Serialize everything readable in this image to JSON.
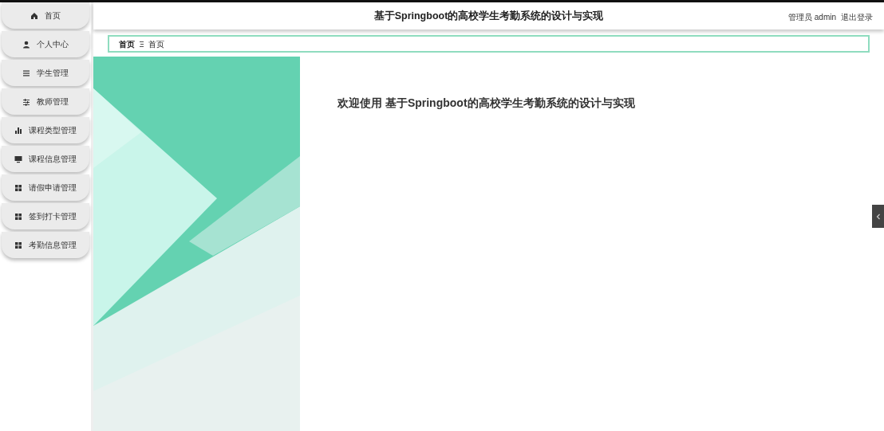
{
  "sidebar": {
    "items": [
      {
        "label": "首页",
        "kind": "home"
      },
      {
        "label": "个人中心",
        "kind": "user"
      },
      {
        "label": "学生管理",
        "kind": "list"
      },
      {
        "label": "教师管理",
        "kind": "sliders"
      },
      {
        "label": "课程类型管理",
        "kind": "chart"
      },
      {
        "label": "课程信息管理",
        "kind": "monitor"
      },
      {
        "label": "请假申请管理",
        "kind": "grid"
      },
      {
        "label": "签到打卡管理",
        "kind": "grid"
      },
      {
        "label": "考勤信息管理",
        "kind": "grid"
      }
    ]
  },
  "header": {
    "title": "基于Springboot的高校学生考勤系统的设计与实现",
    "user": "管理员 admin",
    "logout": "退出登录"
  },
  "breadcrumb": [
    "首页",
    "首页"
  ],
  "main": {
    "welcome": "欢迎使用 基于Springboot的高校学生考勤系统的设计与实现"
  }
}
